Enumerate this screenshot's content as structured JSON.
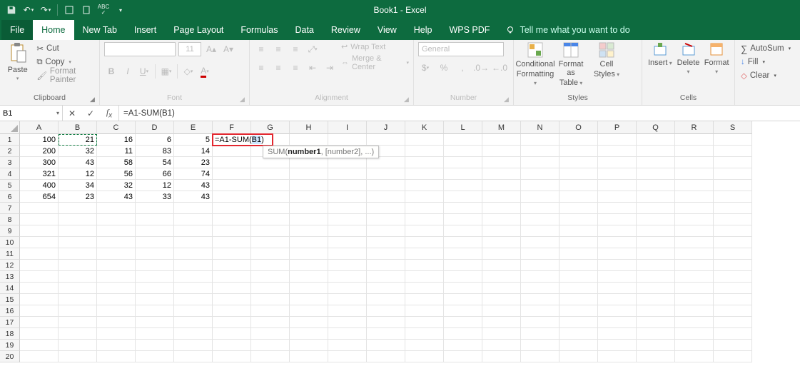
{
  "app": {
    "title": "Book1  -  Excel"
  },
  "menu": {
    "file": "File",
    "home": "Home",
    "newtab": "New Tab",
    "insert": "Insert",
    "pagelayout": "Page Layout",
    "formulas": "Formulas",
    "data": "Data",
    "review": "Review",
    "view": "View",
    "help": "Help",
    "wps": "WPS PDF",
    "tellme": "Tell me what you want to do"
  },
  "ribbon": {
    "clipboard": {
      "label": "Clipboard",
      "paste": "Paste",
      "cut": "Cut",
      "copy": "Copy",
      "painter": "Format Painter"
    },
    "font": {
      "label": "Font",
      "size": "11"
    },
    "alignment": {
      "label": "Alignment",
      "wrap": "Wrap Text",
      "merge": "Merge & Center"
    },
    "number": {
      "label": "Number",
      "general": "General"
    },
    "styles": {
      "label": "Styles",
      "cond": "Conditional",
      "cond2": "Formatting",
      "fmt": "Format as",
      "fmt2": "Table",
      "cell": "Cell",
      "cell2": "Styles"
    },
    "cells": {
      "label": "Cells",
      "insert": "Insert",
      "delete": "Delete",
      "format": "Format"
    },
    "editing": {
      "autosum": "AutoSum",
      "fill": "Fill",
      "clear": "Clear"
    }
  },
  "namebox": {
    "ref": "B1"
  },
  "formula": "=A1-SUM(B1)",
  "columns": [
    "A",
    "B",
    "C",
    "D",
    "E",
    "F",
    "G",
    "H",
    "I",
    "J",
    "K",
    "L",
    "M",
    "N",
    "O",
    "P",
    "Q",
    "R",
    "S"
  ],
  "rows": 20,
  "cell_data": {
    "A": [
      100,
      200,
      300,
      321,
      400,
      654
    ],
    "B": [
      21,
      32,
      43,
      12,
      34,
      23
    ],
    "C": [
      16,
      11,
      58,
      56,
      32,
      43
    ],
    "D": [
      6,
      83,
      54,
      66,
      12,
      33
    ],
    "E": [
      5,
      14,
      23,
      74,
      43,
      43
    ]
  },
  "f1_text": "=A1-SUM(B1)",
  "tooltip": {
    "fn": "SUM(",
    "arg1": "number1",
    "rest": ", [number2], ...)"
  },
  "highlights": {
    "b1_cell": "B1",
    "f1_formula_box": "F1"
  }
}
